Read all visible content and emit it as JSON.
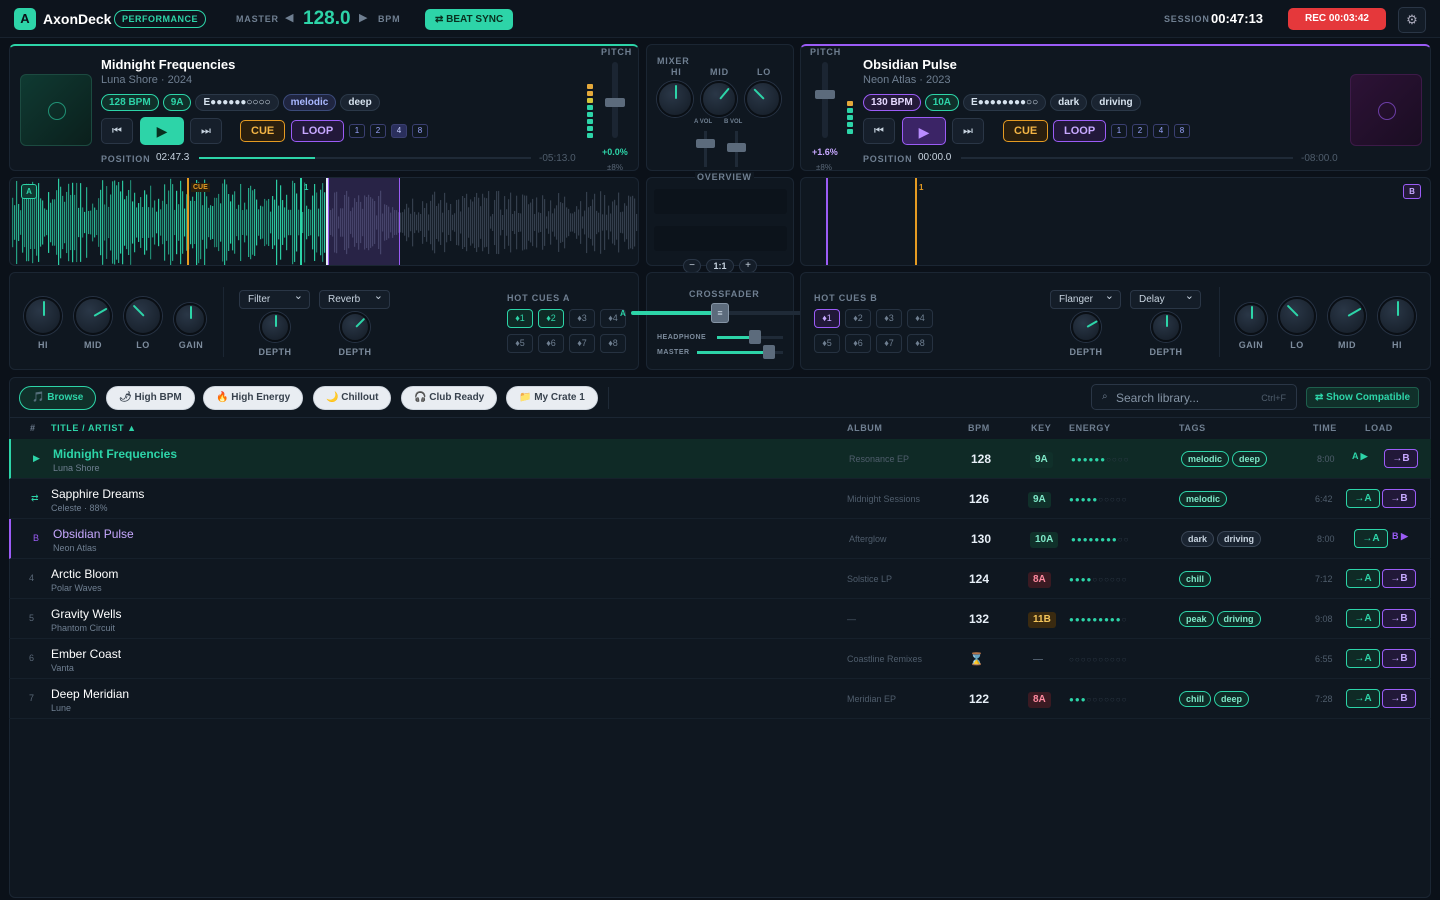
{
  "app": {
    "name": "AxonDeck",
    "mode": "PERFORMANCE",
    "logo": "A"
  },
  "topbar": {
    "master_label": "MASTER",
    "master_bpm": "128.0",
    "bpm_unit": "BPM",
    "beat_sync": "⇄ BEAT SYNC",
    "session_label": "SESSION",
    "session_time": "00:47:13",
    "rec": "REC 00:03:42"
  },
  "deckA": {
    "title": "Midnight Frequencies",
    "meta": "Luna Shore · 2024",
    "bpm": "128 BPM",
    "key": "9A",
    "energy": "E●●●●●●○○○○",
    "tags": [
      "melodic",
      "deep"
    ],
    "cue": "CUE",
    "loop": "LOOP",
    "loop_sizes": [
      "1",
      "2",
      "4",
      "8"
    ],
    "position_label": "POSITION",
    "position": "02:47.3",
    "remaining": "-05:13.0",
    "pitch_label": "PITCH",
    "pitch": "+0.0%",
    "pitch_range": "±8%",
    "progress": 0.35,
    "letter": "A",
    "cue_marker": "CUE",
    "marker": "1"
  },
  "deckB": {
    "title": "Obsidian Pulse",
    "meta": "Neon Atlas · 2023",
    "bpm": "130 BPM",
    "key": "10A",
    "energy": "E●●●●●●●●○○",
    "tags": [
      "dark",
      "driving"
    ],
    "cue": "CUE",
    "loop": "LOOP",
    "loop_sizes": [
      "1",
      "2",
      "4",
      "8"
    ],
    "position_label": "POSITION",
    "position": "00:00.0",
    "remaining": "-08:00.0",
    "pitch_label": "PITCH",
    "pitch": "+1.6%",
    "pitch_range": "±8%",
    "progress": 0.0,
    "letter": "B",
    "marker": "1"
  },
  "mixer": {
    "label": "MIXER",
    "hi": "HI",
    "mid": "MID",
    "lo": "LO",
    "a_vol": "A VOL",
    "b_vol": "B VOL",
    "overview": "OVERVIEW",
    "zoom_out": "−",
    "zoom": "1:1",
    "zoom_in": "+",
    "crossfader": "CROSSFADER",
    "headphone": "HEADPHONE",
    "master": "MASTER",
    "cf_a": "A",
    "cf_b": "B"
  },
  "eqA": {
    "hi": "HI",
    "mid": "MID",
    "lo": "LO",
    "gain": "GAIN",
    "fx1": "Filter",
    "fx2": "Reverb",
    "depth": "DEPTH",
    "hotcues_label": "HOT CUES A",
    "hotcues": [
      "♦1",
      "♦2",
      "♦3",
      "♦4",
      "♦5",
      "♦6",
      "♦7",
      "♦8"
    ]
  },
  "eqB": {
    "hi": "HI",
    "mid": "MID",
    "lo": "LO",
    "gain": "GAIN",
    "fx1": "Flanger",
    "fx2": "Delay",
    "depth": "DEPTH",
    "hotcues_label": "HOT CUES B",
    "hotcues": [
      "♦1",
      "♦2",
      "♦3",
      "♦4",
      "♦5",
      "♦6",
      "♦7",
      "♦8"
    ]
  },
  "library": {
    "filters": [
      "🎵 Browse",
      "🌶 High BPM",
      "🔥 High Energy",
      "🌙 Chillout",
      "🎧 Club Ready",
      "📁 My Crate 1"
    ],
    "search_placeholder": "Search library...",
    "search_shortcut": "Ctrl+F",
    "show_compatible": "⇄ Show Compatible",
    "columns": {
      "num": "#",
      "title": "TITLE / ARTIST ▲",
      "album": "ALBUM",
      "bpm": "BPM",
      "key": "KEY",
      "energy": "ENERGY",
      "tags": "TAGS",
      "time": "TIME",
      "load": "LOAD"
    },
    "rows": [
      {
        "num": "▶",
        "title": "Midnight Frequencies",
        "artist": "Luna Shore",
        "album": "Resonance EP",
        "bpm": "128",
        "key": "9A",
        "energy": "●●●●●●○○○○",
        "tags": [
          "melodic",
          "deep"
        ],
        "time": "8:00",
        "loadA": "A ▶",
        "loadB": "→B"
      },
      {
        "num": "⇄",
        "title": "Sapphire Dreams",
        "artist": "Celeste · 88%",
        "album": "Midnight Sessions",
        "bpm": "126",
        "key": "9A",
        "energy": "●●●●●○○○○○",
        "tags": [
          "melodic"
        ],
        "time": "6:42",
        "loadA": "→A",
        "loadB": "→B"
      },
      {
        "num": "B",
        "title": "Obsidian Pulse",
        "artist": "Neon Atlas",
        "album": "Afterglow",
        "bpm": "130",
        "key": "10A",
        "energy": "●●●●●●●●○○",
        "tags": [
          "dark",
          "driving"
        ],
        "time": "8:00",
        "loadA": "→A",
        "loadB": "B ▶"
      },
      {
        "num": "4",
        "title": "Arctic Bloom",
        "artist": "Polar Waves",
        "album": "Solstice LP",
        "bpm": "124",
        "key": "8A",
        "energy": "●●●●○○○○○○",
        "tags": [
          "chill"
        ],
        "time": "7:12",
        "loadA": "→A",
        "loadB": "→B"
      },
      {
        "num": "5",
        "title": "Gravity Wells",
        "artist": "Phantom Circuit",
        "album": "—",
        "bpm": "132",
        "key": "11B",
        "energy": "●●●●●●●●●○",
        "tags": [
          "peak",
          "driving"
        ],
        "time": "9:08",
        "loadA": "→A",
        "loadB": "→B"
      },
      {
        "num": "6",
        "title": "Ember Coast",
        "artist": "Vanta",
        "album": "Coastline Remixes",
        "bpm": "⌛",
        "key": "—",
        "energy": "○○○○○○○○○○",
        "tags": [],
        "time": "6:55",
        "loadA": "→A",
        "loadB": "→B"
      },
      {
        "num": "7",
        "title": "Deep Meridian",
        "artist": "Lune",
        "album": "Meridian EP",
        "bpm": "122",
        "key": "8A",
        "energy": "●●●○○○○○○○",
        "tags": [
          "chill",
          "deep"
        ],
        "time": "7:28",
        "loadA": "→A",
        "loadB": "→B"
      }
    ]
  },
  "colors": {
    "accentA": "#2dd4a8",
    "accentB": "#9b5cf6",
    "cue": "#e59b22",
    "rec": "#e5383b"
  }
}
